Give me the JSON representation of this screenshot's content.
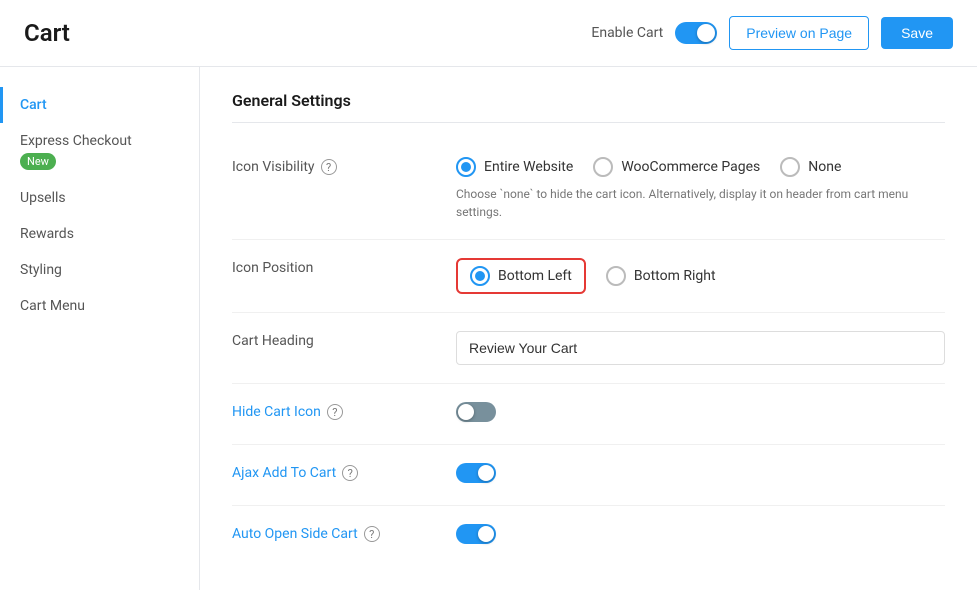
{
  "header": {
    "title": "Cart",
    "enable_cart_label": "Enable Cart",
    "enable_cart_on": true,
    "preview_label": "Preview on Page",
    "save_label": "Save"
  },
  "sidebar": {
    "items": [
      {
        "id": "cart",
        "label": "Cart",
        "active": true
      },
      {
        "id": "express-checkout",
        "label": "Express Checkout",
        "badge": "New"
      },
      {
        "id": "upsells",
        "label": "Upsells"
      },
      {
        "id": "rewards",
        "label": "Rewards"
      },
      {
        "id": "styling",
        "label": "Styling"
      },
      {
        "id": "cart-menu",
        "label": "Cart Menu"
      }
    ]
  },
  "content": {
    "section_title": "General Settings",
    "icon_visibility": {
      "label": "Icon Visibility",
      "options": [
        {
          "id": "entire-website",
          "label": "Entire Website",
          "checked": true
        },
        {
          "id": "woocommerce-pages",
          "label": "WooCommerce Pages",
          "checked": false
        },
        {
          "id": "none",
          "label": "None",
          "checked": false
        }
      ],
      "help_text": "Choose `none` to hide the cart icon. Alternatively, display it on header from cart menu settings."
    },
    "icon_position": {
      "label": "Icon Position",
      "options": [
        {
          "id": "bottom-left",
          "label": "Bottom Left",
          "checked": true,
          "highlighted": true
        },
        {
          "id": "bottom-right",
          "label": "Bottom Right",
          "checked": false
        }
      ]
    },
    "cart_heading": {
      "label": "Cart Heading",
      "value": "Review Your Cart",
      "placeholder": "Review Your Cart"
    },
    "hide_cart_icon": {
      "label": "Hide Cart Icon",
      "on": false
    },
    "ajax_add_to_cart": {
      "label": "Ajax Add To Cart",
      "on": true
    },
    "auto_open_side_cart": {
      "label": "Auto Open Side Cart",
      "on": true
    }
  }
}
